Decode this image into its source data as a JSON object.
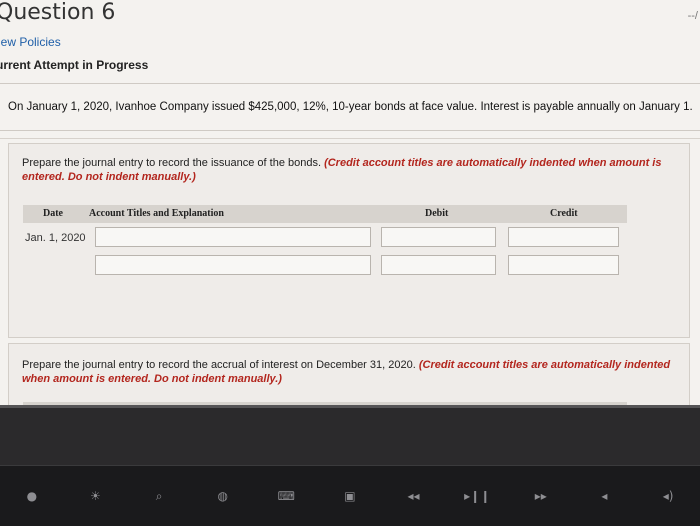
{
  "header": {
    "title": "Question 6",
    "corner": "--/",
    "policies_link": "iew Policies",
    "attempt_label": "urrent Attempt in Progress"
  },
  "problem": {
    "text": "On January 1, 2020, Ivanhoe Company issued $425,000, 12%, 10-year bonds at face value. Interest is payable annually on January 1."
  },
  "part1": {
    "instruction": "Prepare the journal entry to record the issuance of the bonds.",
    "note": "(Credit account titles are automatically indented when amount is entered. Do not indent manually.)",
    "columns": {
      "date": "Date",
      "account": "Account Titles and Explanation",
      "debit": "Debit",
      "credit": "Credit"
    },
    "date_value": "Jan. 1, 2020",
    "rows": [
      {
        "account": "",
        "debit": "",
        "credit": ""
      },
      {
        "account": "",
        "debit": "",
        "credit": ""
      }
    ]
  },
  "part2": {
    "instruction": "Prepare the journal entry to record the accrual of interest on December 31, 2020.",
    "note": "(Credit account titles are automatically indented when amount is entered. Do not indent manually.)"
  },
  "touchbar": {
    "icons": [
      "escape-key-icon",
      "brightness-icon",
      "search-icon",
      "globe-icon",
      "keyboard-icon",
      "camera-icon",
      "rewind-icon",
      "play-pause-icon",
      "fast-forward-icon",
      "mute-icon",
      "volume-icon"
    ]
  }
}
